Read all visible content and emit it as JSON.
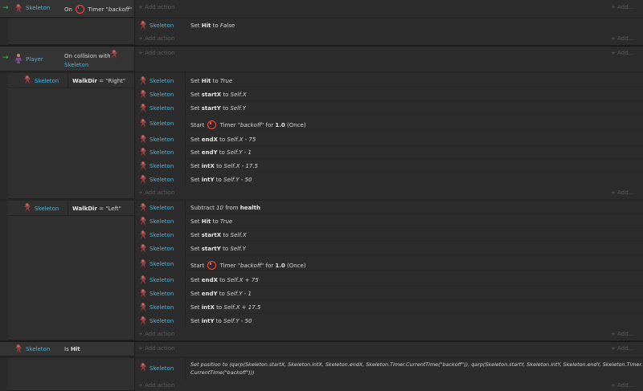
{
  "ui": {
    "add_action": "Add action",
    "add_short": "Add..."
  },
  "events": {
    "e1": {
      "object": "Skeleton",
      "condition_prefix": "On",
      "timer_label": "Timer",
      "timer_name": "\"backoff\""
    },
    "e1_actions": [
      {
        "object": "Skeleton",
        "set": "Set",
        "var": "Hit",
        "to": "to",
        "value": "False"
      }
    ],
    "e2": {
      "object": "Player",
      "condition_line1": "On collision with",
      "condition_object": "Skeleton"
    },
    "e2a": {
      "object": "Skeleton",
      "var": "WalkDir",
      "op": "=",
      "value": "\"Right\""
    },
    "e2a_actions": [
      {
        "object": "Skeleton",
        "set": "Set",
        "var": "Hit",
        "to": "to",
        "value": "True"
      },
      {
        "object": "Skeleton",
        "set": "Set",
        "var": "startX",
        "to": "to",
        "value": "Self.X"
      },
      {
        "object": "Skeleton",
        "set": "Set",
        "var": "startY",
        "to": "to",
        "value": "Self.Y"
      },
      {
        "object": "Skeleton",
        "start": "Start",
        "timer_label": "Timer",
        "timer_name": "\"backoff\"",
        "for": "for",
        "duration": "1.0",
        "mode": "(Once)"
      },
      {
        "object": "Skeleton",
        "set": "Set",
        "var": "endX",
        "to": "to",
        "value": "Self.X - 75"
      },
      {
        "object": "Skeleton",
        "set": "Set",
        "var": "endY",
        "to": "to",
        "value": "Self.Y - 1"
      },
      {
        "object": "Skeleton",
        "set": "Set",
        "var": "intX",
        "to": "to",
        "value": "Self.X - 17.5"
      },
      {
        "object": "Skeleton",
        "set": "Set",
        "var": "intY",
        "to": "to",
        "value": "Self.Y - 50"
      }
    ],
    "e2b": {
      "object": "Skeleton",
      "var": "WalkDir",
      "op": "=",
      "value": "\"Left\""
    },
    "e2b_actions": [
      {
        "object": "Skeleton",
        "subtract": "Subtract",
        "amount": "10",
        "from": "from",
        "var": "health"
      },
      {
        "object": "Skeleton",
        "set": "Set",
        "var": "Hit",
        "to": "to",
        "value": "True"
      },
      {
        "object": "Skeleton",
        "set": "Set",
        "var": "startX",
        "to": "to",
        "value": "Self.X"
      },
      {
        "object": "Skeleton",
        "set": "Set",
        "var": "startY",
        "to": "to",
        "value": "Self.Y"
      },
      {
        "object": "Skeleton",
        "start": "Start",
        "timer_label": "Timer",
        "timer_name": "\"backoff\"",
        "for": "for",
        "duration": "1.0",
        "mode": "(Once)"
      },
      {
        "object": "Skeleton",
        "set": "Set",
        "var": "endX",
        "to": "to",
        "value": "Self.X + 75"
      },
      {
        "object": "Skeleton",
        "set": "Set",
        "var": "endY",
        "to": "to",
        "value": "Self.Y - 1"
      },
      {
        "object": "Skeleton",
        "set": "Set",
        "var": "intX",
        "to": "to",
        "value": "Self.X + 17.5"
      },
      {
        "object": "Skeleton",
        "set": "Set",
        "var": "intY",
        "to": "to",
        "value": "Self.Y - 50"
      }
    ],
    "e3": {
      "object": "Skeleton",
      "condition_prefix": "Is",
      "var": "Hit"
    },
    "e3_actions": [
      {
        "object": "Skeleton",
        "line1": "Set position to (qarp(Skeleton.startX, Skeleton.intX, Skeleton.endX, Skeleton.Timer.CurrentTime(\"backoff\")), qarp(Skeleton.startY, Skeleton.intY, Skeleton.endY, Skeleton.Timer.",
        "line2": "CurrentTime(\"backoff\")))"
      }
    ]
  },
  "icons": {
    "skeleton": "skeleton-sprite-icon",
    "player": "player-sprite-icon",
    "timer": "timer-icon",
    "trigger": "trigger-arrow-icon"
  },
  "colors": {
    "object_name": "#46b6df",
    "timer": "#ff4a3a",
    "trigger_arrow": "#36c25a",
    "background": "#2b2b2b"
  }
}
